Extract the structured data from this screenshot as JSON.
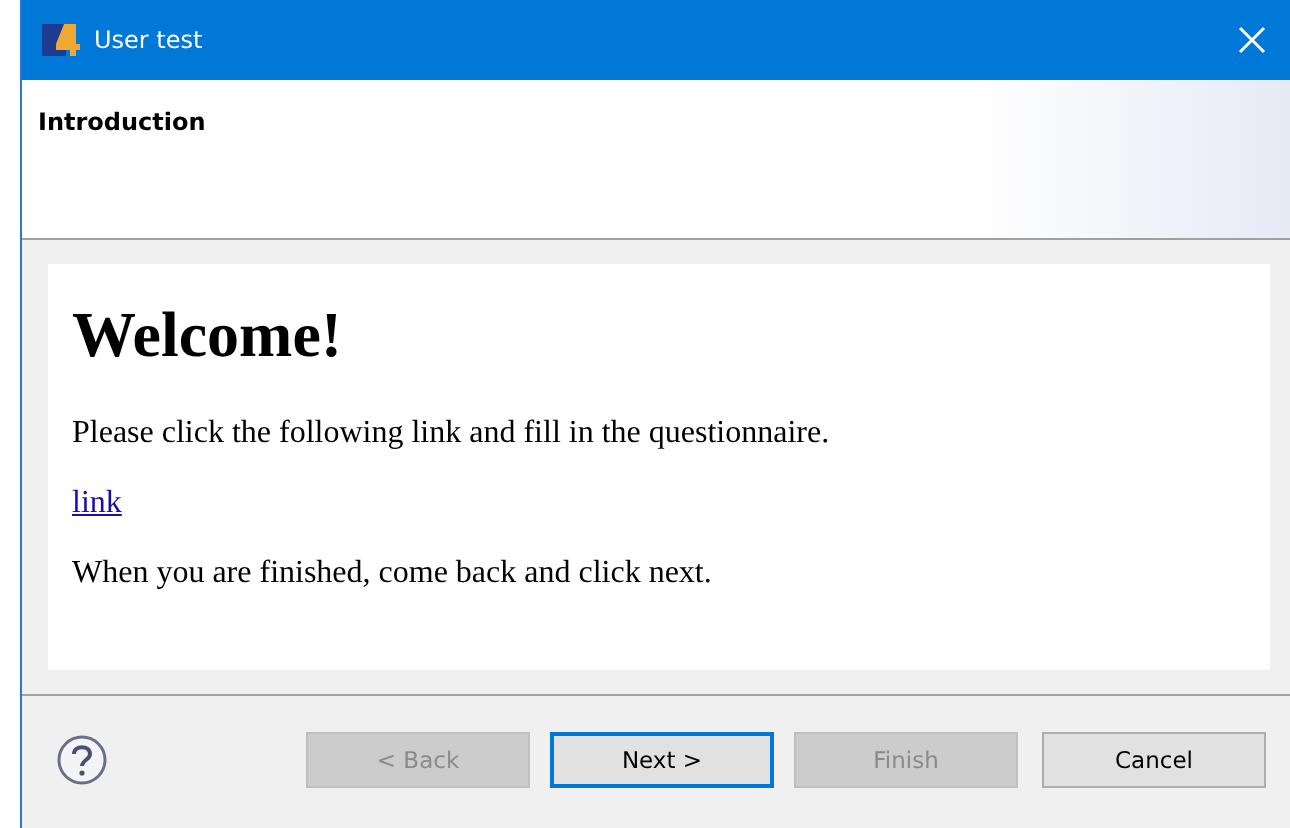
{
  "window": {
    "title": "User test"
  },
  "header": {
    "title": "Introduction"
  },
  "content": {
    "heading": "Welcome!",
    "paragraphs": [
      {
        "kind": "text",
        "text": "Please click the following link and fill in the questionnaire."
      },
      {
        "kind": "link",
        "text": "link"
      },
      {
        "kind": "text",
        "text": "When you are finished, come back and click next."
      }
    ]
  },
  "buttons": [
    {
      "label": "< Back",
      "disabled": true,
      "default": false
    },
    {
      "label": "Next >",
      "disabled": false,
      "default": true
    },
    {
      "label": "Finish",
      "disabled": true,
      "default": false
    },
    {
      "label": "Cancel",
      "disabled": false,
      "default": false
    }
  ]
}
